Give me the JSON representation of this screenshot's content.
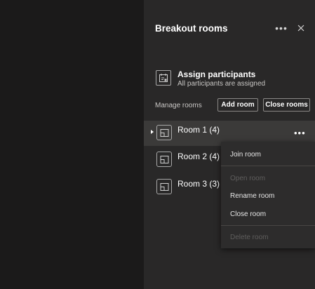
{
  "panel": {
    "title": "Breakout rooms",
    "more_icon": "more-horizontal-icon",
    "close_icon": "close-icon"
  },
  "assign": {
    "icon": "assign-participants-icon",
    "title": "Assign participants",
    "subtitle": "All participants are assigned"
  },
  "manage": {
    "label": "Manage rooms",
    "add_label": "Add room",
    "close_label": "Close rooms"
  },
  "rooms": [
    {
      "label": "Room 1 (4)",
      "selected": true,
      "icon": "room-icon"
    },
    {
      "label": "Room 2 (4)",
      "selected": false,
      "icon": "room-icon"
    },
    {
      "label": "Room 3 (3)",
      "selected": false,
      "icon": "room-icon"
    }
  ],
  "menu": {
    "items": [
      {
        "label": "Join room",
        "enabled": true
      },
      {
        "label": "Open room",
        "enabled": false
      },
      {
        "label": "Rename room",
        "enabled": true
      },
      {
        "label": "Close room",
        "enabled": true
      },
      {
        "label": "Delete room",
        "enabled": false
      }
    ]
  },
  "colors": {
    "background": "#1b1a1a",
    "panel": "#292828",
    "selected_row": "#3b3a39",
    "menu": "#2d2c2c",
    "disabled_text": "#5f5e5d"
  }
}
